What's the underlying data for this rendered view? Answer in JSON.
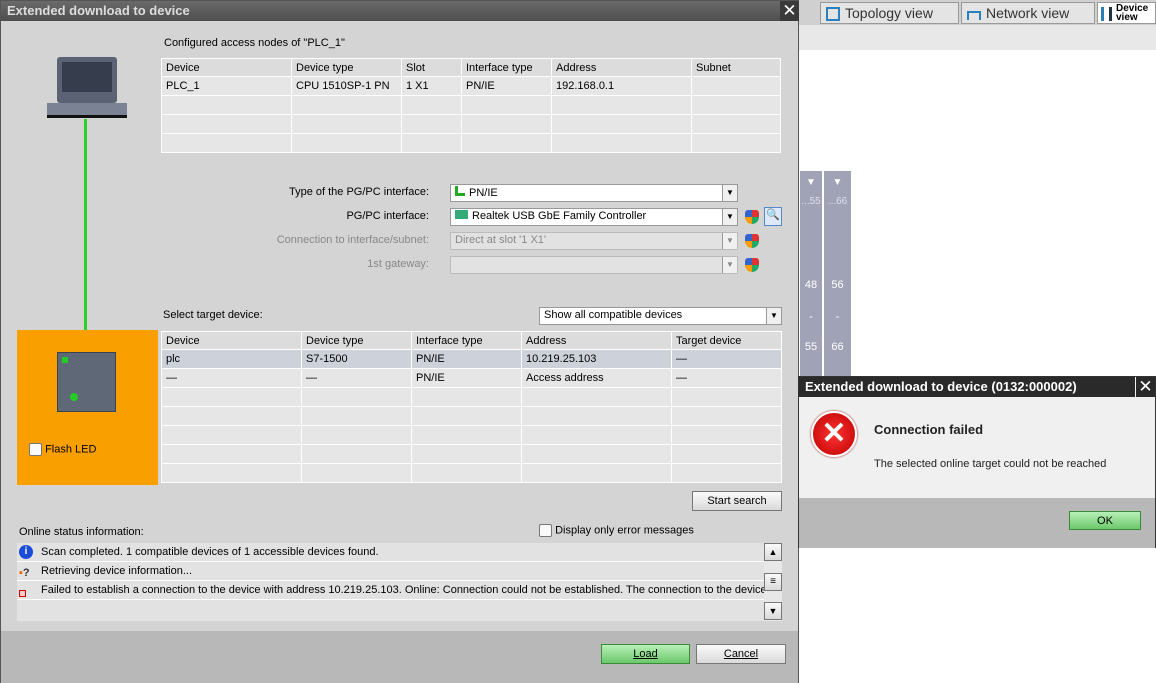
{
  "dialog": {
    "title": "Extended download to device",
    "close": "✕"
  },
  "configured": {
    "title": "Configured access nodes of \"PLC_1\"",
    "columns": [
      "Device",
      "Device type",
      "Slot",
      "Interface type",
      "Address",
      "Subnet"
    ],
    "rows": [
      [
        "PLC_1",
        "CPU 1510SP-1 PN",
        "1 X1",
        "PN/IE",
        "192.168.0.1",
        ""
      ]
    ]
  },
  "form": {
    "type_label": "Type of the PG/PC interface:",
    "type_value": "PN/IE",
    "iface_label": "PG/PC interface:",
    "iface_value": "Realtek USB GbE Family Controller",
    "conn_label": "Connection to interface/subnet:",
    "conn_value": "Direct at slot '1 X1'",
    "gw_label": "1st gateway:",
    "gw_value": ""
  },
  "target": {
    "label": "Select target device:",
    "filter": "Show all compatible devices",
    "columns": [
      "Device",
      "Device type",
      "Interface type",
      "Address",
      "Target device"
    ],
    "rows": [
      [
        "plc",
        "S7-1500",
        "PN/IE",
        "10.219.25.103",
        "—"
      ],
      [
        "—",
        "—",
        "PN/IE",
        "Access address",
        "—"
      ]
    ]
  },
  "flash_led": "Flash LED",
  "start_search": "Start search",
  "status": {
    "label": "Online status information:",
    "only_errors": "Display only error messages",
    "messages": [
      "Scan completed. 1 compatible devices of 1 accessible devices found.",
      "Retrieving device information...",
      "Failed to establish a connection to the device with address 10.219.25.103. Online: Connection could not be established. The connection to the device could not be established."
    ]
  },
  "buttons": {
    "load": "Load",
    "cancel": "Cancel"
  },
  "bg": {
    "tabs": [
      "Topology view",
      "Network view",
      "Device view"
    ],
    "col_heads": [
      "...55",
      "...66"
    ],
    "col_vals": [
      [
        "48",
        "-",
        "55"
      ],
      [
        "56",
        "-",
        "66"
      ]
    ]
  },
  "error": {
    "title": "Extended download to device (0132:000002)",
    "heading": "Connection failed",
    "message": "The selected online target could not be reached",
    "ok": "OK"
  }
}
